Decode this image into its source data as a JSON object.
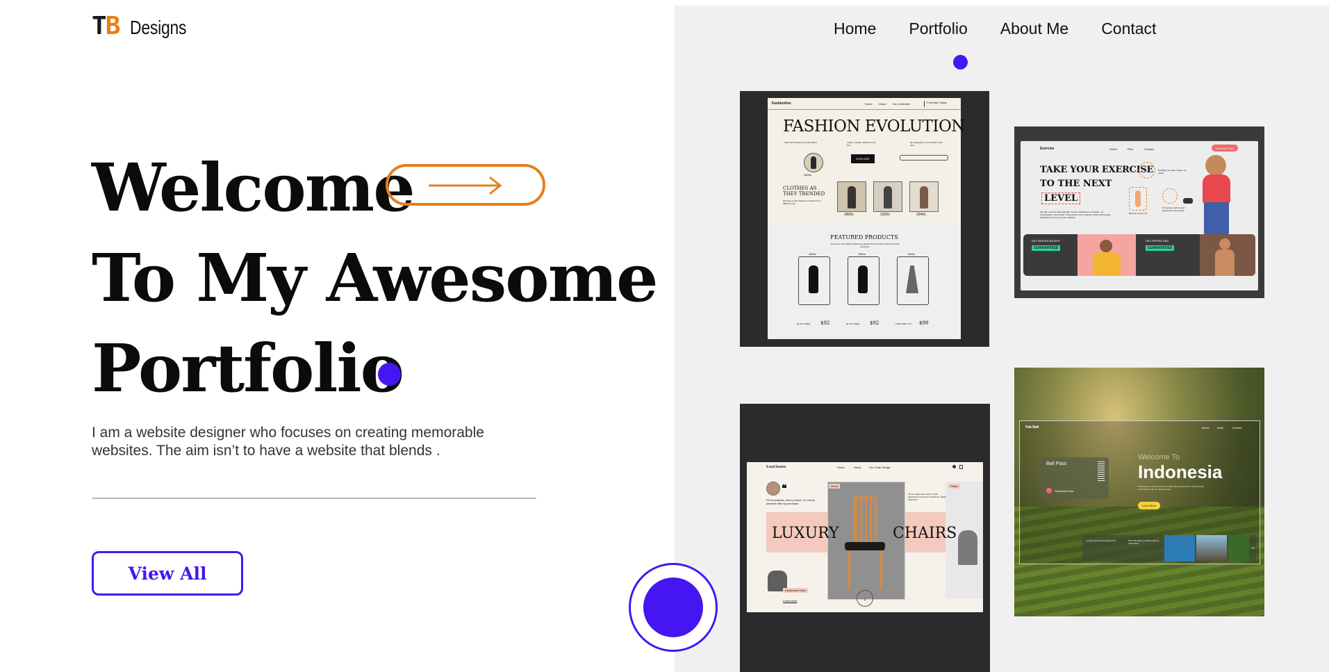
{
  "brand": {
    "mark_t": "T",
    "mark_b": "B",
    "name": "Designs"
  },
  "nav": {
    "items": [
      "Home",
      "Portfolio",
      "About Me",
      "Contact"
    ],
    "active": "Portfolio"
  },
  "hero": {
    "line1": "Welcome",
    "line2": "To My Awesome",
    "line3": "Portfolio",
    "description": "I am a website designer who focuses on creating memorable websites. The aim isn’t to have a website that blends .",
    "cta": "View All"
  },
  "colors": {
    "accent": "#4616f2",
    "orange": "#e57f1d",
    "panel": "#f0f0f0",
    "dark": "#2b2b2b"
  },
  "portfolio": {
    "fashion": {
      "brand": "Fashionline",
      "nav": [
        "Home",
        "About",
        "Our Collection"
      ],
      "nav_btn": "Purchase Today",
      "title": "FASHION EVOLUTION",
      "small_text_a": "Step back through time with fashion",
      "small_text_b": "Classic, vintage outfits from the time",
      "small_text_c": "Be transported, our products to the past",
      "explore": "EXPLORE",
      "years_label": "1800s",
      "clothes": "CLOTHES AS THEY TRENDED",
      "clothes_sub": "We have a wide selection of clothes from different eras",
      "eras": [
        "1800s",
        "1920s",
        "1940s"
      ],
      "featured": "FEATURED PRODUCTS",
      "featured_sub": "These are best selling products as well as the best loved by all of our loyal customers",
      "products": [
        {
          "era": "1800s",
          "name": "BL ACK 1800s",
          "price": "$92"
        },
        {
          "era": "1800s",
          "name": "BL ACK 1800s",
          "price": "$92"
        },
        {
          "era": "1940s",
          "name": "1940s GREY CO...",
          "price": "$99"
        }
      ]
    },
    "exercise": {
      "brand": "Exercise",
      "nav": [
        "Home",
        "Plan",
        "Contact"
      ],
      "nav_btn": "Purchase Plan",
      "title_1": "TAKE YOUR EXERCISE",
      "title_2": "TO THE NEXT",
      "title_3": "LEVEL",
      "body": "We offer exercise plans that GET results, guaranteed, no hassle - no complications. Just results. Using science your workouts routine will be easy and tailored for you and your progress.",
      "note_a": "Noticably stronger in days, not weeks",
      "note_b": "Become a new you!",
      "note_c": "Our unique workout plan guarantees safe growth",
      "card1_top": "GET BIGGER BICEPS",
      "card1_badge": "GUARANTEED",
      "card2_top": "GET RIPPED ABS",
      "card2_badge": "GUARANTEED"
    },
    "chairs": {
      "brand": "LuxChairs",
      "nav": [
        "Home",
        "About",
        "Our Chair Range"
      ],
      "quote": "Fit for purpose, luxury chairs. I'm overly pleased with my purchase",
      "tag_wood": "Wood",
      "tag_fabric": "Fabric",
      "right_quote": "All our chairs come with a 5 year guarantee to hold your comfort for quality assurance",
      "title_left": "LUXURY",
      "title_right": "CHAIRS",
      "product": "Cushioned Chair",
      "learn": "Learn More"
    },
    "indonesia": {
      "brand": "Fab Bali",
      "nav": [
        "Wood",
        "Book",
        "Contact"
      ],
      "pass": "Bali Pass",
      "person": "Samantha Dow",
      "welcome": "Welcome To",
      "title": "Indonesia",
      "sub": "Indonesia is a country of over 17,000 islands, Experience Indonesia like never before with our premium pass",
      "btn": "Learn More",
      "card_a": "Unlock your bali with guide here",
      "card_b": "50% Off! When you Book with us. Learn More"
    }
  }
}
